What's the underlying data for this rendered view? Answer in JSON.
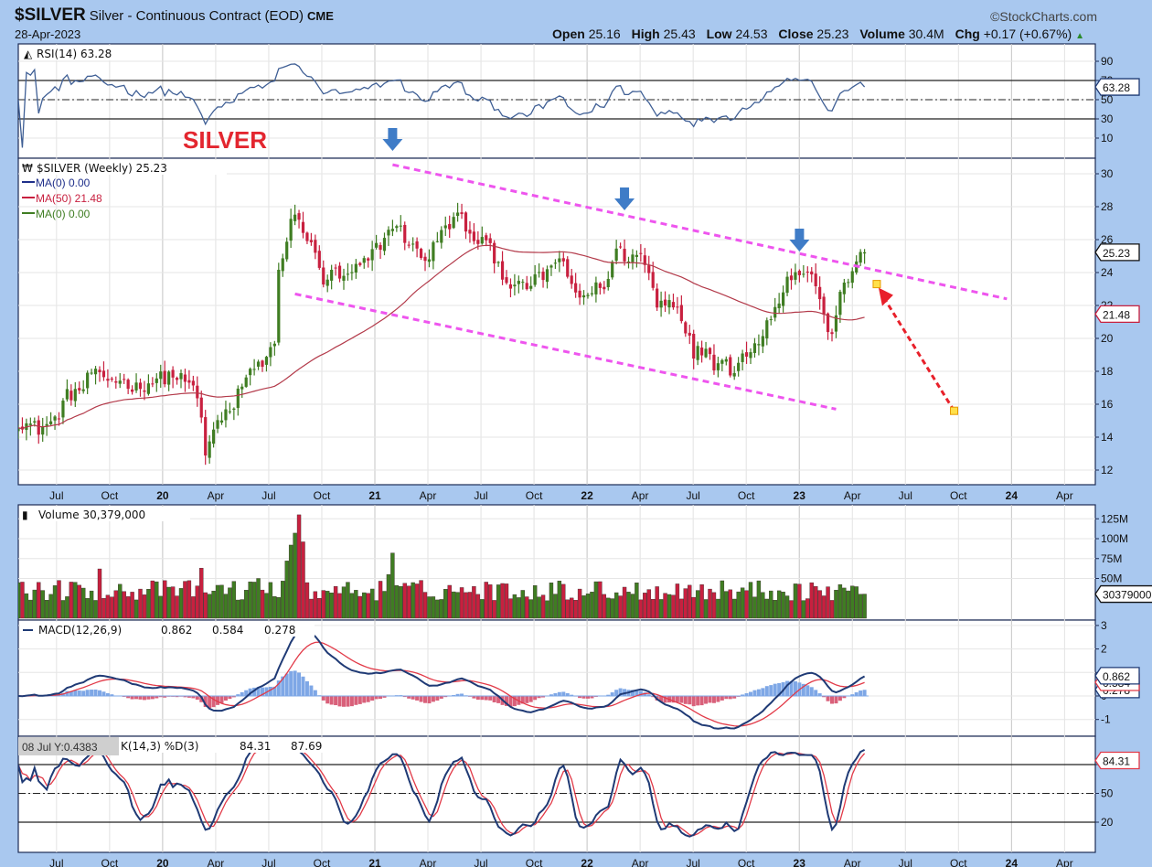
{
  "header": {
    "symbol": "$SILVER",
    "description": "Silver - Continuous Contract (EOD)",
    "exchange": "CME",
    "date": "28-Apr-2023",
    "brand": "©StockCharts.com",
    "open_label": "Open",
    "open": "25.16",
    "high_label": "High",
    "high": "25.43",
    "low_label": "Low",
    "low": "24.53",
    "close_label": "Close",
    "close": "25.23",
    "volume_label": "Volume",
    "volume": "30.4M",
    "chg_label": "Chg",
    "chg": "+0.17 (+0.67%)",
    "chg_arrow": "▲"
  },
  "annotation_title": "SILVER",
  "colors": {
    "up": "#3f7d22",
    "down": "#c8203f",
    "ma50": "#b33a4a",
    "macd": "#1f3a75",
    "signal": "#e23a48",
    "hist_pos": "#7ea7e6",
    "hist_neg": "#d9607a",
    "trend": "#ee55ee",
    "arrow": "#e8202a",
    "marker": "#3f7cc7"
  },
  "panels": {
    "rsi": {
      "label": "RSI(14) 63.28",
      "value_tag": "63.28",
      "ticks": [
        90,
        70,
        50,
        30,
        10
      ],
      "levels": [
        70,
        50,
        30
      ]
    },
    "price": {
      "label": "$SILVER (Weekly) 25.23",
      "legend": [
        "MA(0) 0.00",
        "MA(50) 21.48",
        "MA(0) 0.00"
      ],
      "ticks": [
        30,
        28,
        26,
        24,
        22,
        20,
        18,
        16,
        14,
        12
      ],
      "close_tag": "25.23",
      "ma_tag": "21.48"
    },
    "volume": {
      "label": "Volume 30,379,000",
      "ticks": [
        "125M",
        "100M",
        "75M",
        "50M"
      ],
      "tick_values": [
        125,
        100,
        75,
        50
      ],
      "value_tag": "30379000"
    },
    "macd": {
      "label": "MACD(12,26,9)",
      "v1": "0.862",
      "v2": "0.584",
      "v3": "0.278",
      "ticks": [
        3,
        2,
        1,
        0,
        -1
      ],
      "tags": [
        "0.862",
        "0.584",
        "0.278"
      ]
    },
    "stoch": {
      "tooltip": "08 Jul Y:0.4383",
      "label": "K(14,3) %D(3)",
      "k": "84.31",
      "d": "87.69",
      "ticks": [
        80,
        50,
        20
      ],
      "value_tag": "84.31"
    }
  },
  "chart_data": {
    "type": "candlestick",
    "title": "$SILVER Silver - Continuous Contract (EOD) Weekly",
    "x_unit": "week index (0 = mid-May 2019, 208 = 28-Apr-2023)",
    "x_ticks": [
      "Jul",
      "Oct",
      "20",
      "Apr",
      "Jul",
      "Oct",
      "21",
      "Apr",
      "Jul",
      "Oct",
      "22",
      "Apr",
      "Jul",
      "Oct",
      "23",
      "Apr",
      "Jul",
      "Oct",
      "24",
      "Apr"
    ],
    "first_tick_week": 9.4,
    "weeks_per_tick": 13.04,
    "ylim": [
      11.3,
      30.9
    ],
    "close_path": [
      [
        0,
        15.0
      ],
      [
        5,
        14.5
      ],
      [
        9,
        15.0
      ],
      [
        12,
        16.5
      ],
      [
        16,
        17.0
      ],
      [
        18,
        18.0
      ],
      [
        20,
        17.5
      ],
      [
        25,
        17.5
      ],
      [
        29,
        17.0
      ],
      [
        34,
        17.5
      ],
      [
        38,
        17.8
      ],
      [
        43,
        17.0
      ],
      [
        45,
        15.5
      ],
      [
        46,
        12.5
      ],
      [
        48,
        14.5
      ],
      [
        51,
        15.5
      ],
      [
        53,
        15.5
      ],
      [
        54,
        17.0
      ],
      [
        57,
        18.0
      ],
      [
        61,
        18.5
      ],
      [
        63,
        20.0
      ],
      [
        64,
        24.0
      ],
      [
        66,
        26.0
      ],
      [
        67,
        27.0
      ],
      [
        69,
        27.5
      ],
      [
        71,
        26.0
      ],
      [
        73,
        25.0
      ],
      [
        75,
        23.5
      ],
      [
        78,
        24.0
      ],
      [
        80,
        23.5
      ],
      [
        82,
        24.0
      ],
      [
        85,
        24.5
      ],
      [
        88,
        25.5
      ],
      [
        90,
        26.0
      ],
      [
        92,
        27.0
      ],
      [
        94,
        26.5
      ],
      [
        97,
        25.5
      ],
      [
        99,
        25.0
      ],
      [
        101,
        25.0
      ],
      [
        103,
        26.0
      ],
      [
        106,
        27.0
      ],
      [
        109,
        27.5
      ],
      [
        111,
        26.0
      ],
      [
        114,
        26.0
      ],
      [
        117,
        25.0
      ],
      [
        120,
        23.5
      ],
      [
        124,
        23.0
      ],
      [
        127,
        23.5
      ],
      [
        130,
        24.0
      ],
      [
        133,
        25.0
      ],
      [
        135,
        23.5
      ],
      [
        138,
        22.5
      ],
      [
        142,
        23.0
      ],
      [
        145,
        23.5
      ],
      [
        147,
        25.5
      ],
      [
        149,
        25.0
      ],
      [
        153,
        25.0
      ],
      [
        155,
        24.0
      ],
      [
        157,
        22.0
      ],
      [
        160,
        22.5
      ],
      [
        163,
        21.5
      ],
      [
        166,
        19.0
      ],
      [
        169,
        19.5
      ],
      [
        171,
        18.5
      ],
      [
        173,
        19.0
      ],
      [
        175,
        18.0
      ],
      [
        178,
        19.0
      ],
      [
        180,
        19.0
      ],
      [
        182,
        20.0
      ],
      [
        184,
        21.0
      ],
      [
        187,
        22.5
      ],
      [
        189,
        23.5
      ],
      [
        191,
        24.0
      ],
      [
        193,
        24.0
      ],
      [
        196,
        23.5
      ],
      [
        198,
        21.0
      ],
      [
        200,
        20.5
      ],
      [
        202,
        22.5
      ],
      [
        205,
        24.0
      ],
      [
        207,
        25.5
      ],
      [
        208,
        25.23
      ]
    ],
    "volume_spikes_millions": [
      [
        66,
        72
      ],
      [
        67,
        92
      ],
      [
        68,
        107
      ],
      [
        69,
        130
      ],
      [
        70,
        96
      ],
      [
        92,
        82
      ],
      [
        91,
        55
      ],
      [
        62,
        45
      ],
      [
        20,
        62
      ],
      [
        45,
        63
      ],
      [
        59,
        50
      ]
    ],
    "trendlines": [
      {
        "name": "upper-channel",
        "from": [
          92,
          30.55
        ],
        "to": [
          243,
          22.4
        ]
      },
      {
        "name": "lower-channel",
        "from": [
          68,
          22.7
        ],
        "to": [
          201,
          15.7
        ]
      }
    ],
    "projection_arrow": {
      "from": [
        230,
        15.6
      ],
      "to": [
        211,
        23.3
      ]
    },
    "peak_markers_weeks": [
      92,
      149,
      192
    ]
  }
}
